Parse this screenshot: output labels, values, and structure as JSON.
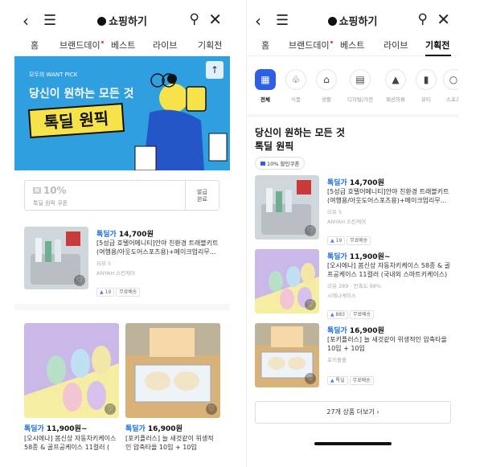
{
  "header": {
    "title": "쇼핑하기"
  },
  "tabs": [
    "홈",
    "브랜드데이",
    "베스트",
    "라이브",
    "기획전"
  ],
  "banner": {
    "eyebrow": "모두의 WANT PICK",
    "headline": "당신이 원하는 모든 것",
    "sticker": "톡딜 원픽"
  },
  "coupon": {
    "n_label": "N",
    "percent": "10%",
    "name": "톡딜 원픽 쿠폰",
    "issue_line1": "발급",
    "issue_line2": "완료"
  },
  "products": [
    {
      "deal": "톡딜가",
      "price": "14,700원",
      "name": "[5성급 호텔어메니티]안야 친환경 트래블키트(여행용/아웃도어스포츠용)+메이크업리무...",
      "review": "리뷰 5",
      "brand": "ANYAH 스킨케어",
      "badge_count": "19",
      "badge_ship": "무료배송"
    },
    {
      "deal": "톡딜가",
      "price": "11,900원~",
      "name": "[오시에나] 봄신상 자동차키케이스 58종 & 골프공케이스 11컬러 (국내외 스마트키케이스)",
      "review": "리뷰 289 · 만족도 98%",
      "brand": "시에나케이스",
      "badge_count": "883",
      "badge_ship": "무료배송"
    },
    {
      "deal": "톡딜가",
      "price": "16,900원",
      "name": "[포키플러스] 늘 새것같이 위생적인 압축타올 10입 + 10입",
      "brand": "포키플플",
      "badge_tok": "톡딜",
      "badge_ship": "무료배송"
    }
  ],
  "left_grid": [
    {
      "deal": "톡딜가",
      "price": "11,900원~",
      "name1": "[오시에나] 봄신상 자동차키케이스",
      "name2": "58종 & 골프공케이스 11컬러 ("
    },
    {
      "deal": "톡딜가",
      "price": "16,900원",
      "name1": "[포키플러스] 늘 새것같이 위생적",
      "name2": "인 압축타올 10입 + 10입"
    }
  ],
  "categories": [
    "전체",
    "식품",
    "생활",
    "디지털/가전",
    "패션의류",
    "뷰티",
    "스포츠"
  ],
  "section": {
    "line1": "당신이 원하는 모든 것",
    "line2": "톡딜 원픽",
    "chip": "10% 할인쿠폰"
  },
  "more_button": "27개 상품 더보기"
}
